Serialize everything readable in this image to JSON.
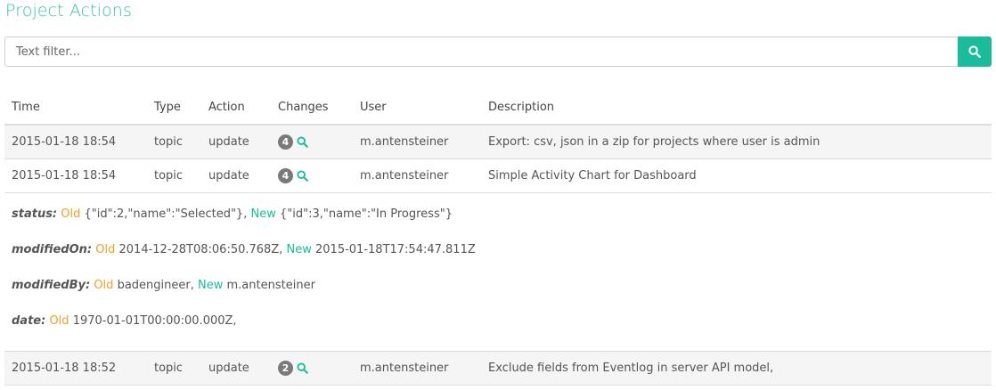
{
  "page": {
    "title": "Project Actions"
  },
  "search": {
    "placeholder": "Text filter...",
    "value": "",
    "icon": "search-icon"
  },
  "colors": {
    "accent": "#1abc9c",
    "old": "#f0a02a",
    "new": "#1abc9c",
    "badge": "#7a7a7a"
  },
  "table": {
    "headers": [
      "Time",
      "Type",
      "Action",
      "Changes",
      "User",
      "Description"
    ],
    "rows": [
      {
        "time": "2015-01-18 18:54",
        "type": "topic",
        "action": "update",
        "changes": "4",
        "user": "m.antensteiner",
        "description": "Export: csv, json in a zip for projects where user is admin"
      },
      {
        "time": "2015-01-18 18:54",
        "type": "topic",
        "action": "update",
        "changes": "4",
        "user": "m.antensteiner",
        "description": "Simple Activity Chart for Dashboard"
      },
      {
        "time": "2015-01-18 18:52",
        "type": "topic",
        "action": "update",
        "changes": "2",
        "user": "m.antensteiner",
        "description": "Exclude fields from Eventlog in server API model,"
      }
    ]
  },
  "details": {
    "old_label": "Old",
    "new_label": "New",
    "changes": [
      {
        "field": "status:",
        "old": "{\"id\":2,\"name\":\"Selected\"},",
        "new": "{\"id\":3,\"name\":\"In Progress\"}"
      },
      {
        "field": "modifiedOn:",
        "old": "2014-12-28T08:06:50.768Z,",
        "new": "2015-01-18T17:54:47.811Z"
      },
      {
        "field": "modifiedBy:",
        "old": "badengineer,",
        "new": "m.antensteiner"
      },
      {
        "field": "date:",
        "old": "1970-01-01T00:00:00.000Z,",
        "new": ""
      }
    ]
  }
}
